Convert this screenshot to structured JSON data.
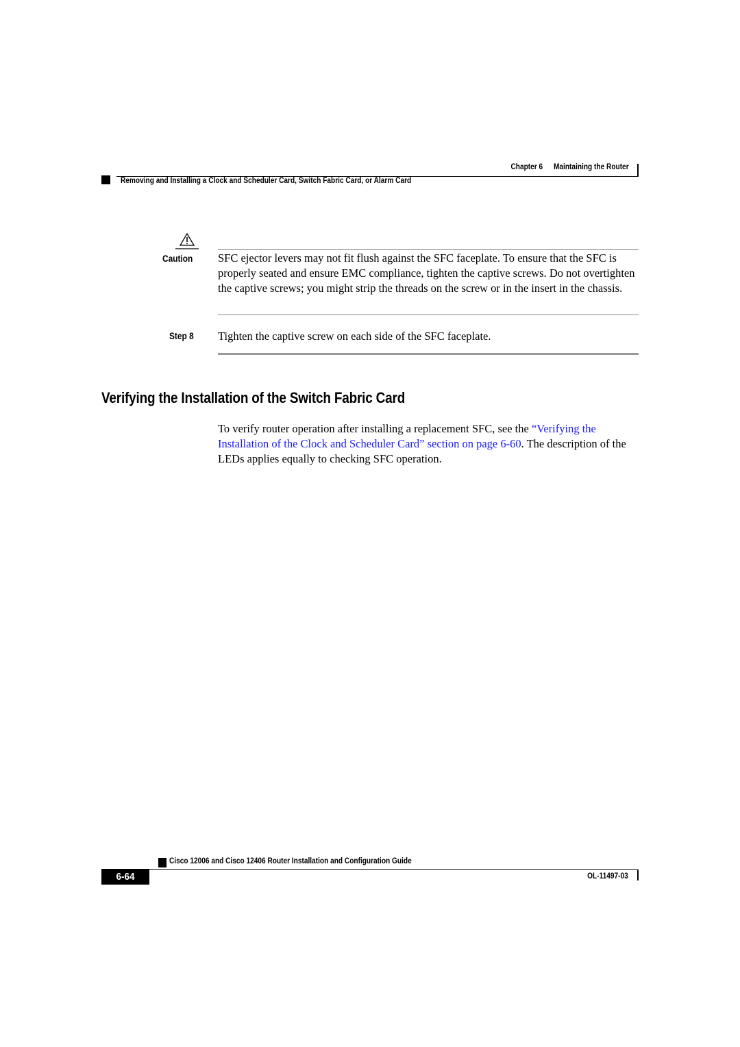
{
  "header": {
    "chapter_label": "Chapter 6",
    "chapter_title": "Maintaining the Router",
    "section_title": "Removing and Installing a Clock and Scheduler Card, Switch Fabric Card, or Alarm Card"
  },
  "caution": {
    "icon": "warning-triangle-icon",
    "label": "Caution",
    "text": "SFC ejector levers may not fit flush against the SFC faceplate. To ensure that the SFC is properly seated and ensure EMC compliance, tighten the captive screws. Do not overtighten the captive screws; you might strip the threads on the screw or in the insert in the chassis."
  },
  "step": {
    "label": "Step 8",
    "text": "Tighten the captive screw on each side of the SFC faceplate."
  },
  "section": {
    "heading": "Verifying the Installation of the Switch Fabric Card",
    "para_before_link": "To verify router operation after installing a replacement SFC, see the ",
    "link_text": "“Verifying the Installation of the Clock and Scheduler Card” section on page 6-60",
    "para_after_link": ". The description of the LEDs applies equally to checking SFC operation.",
    "link_color": "#1a1aff"
  },
  "footer": {
    "guide_title": "Cisco 12006 and Cisco 12406 Router Installation and Configuration Guide",
    "page_number": "6-64",
    "doc_number": "OL-11497-03"
  }
}
